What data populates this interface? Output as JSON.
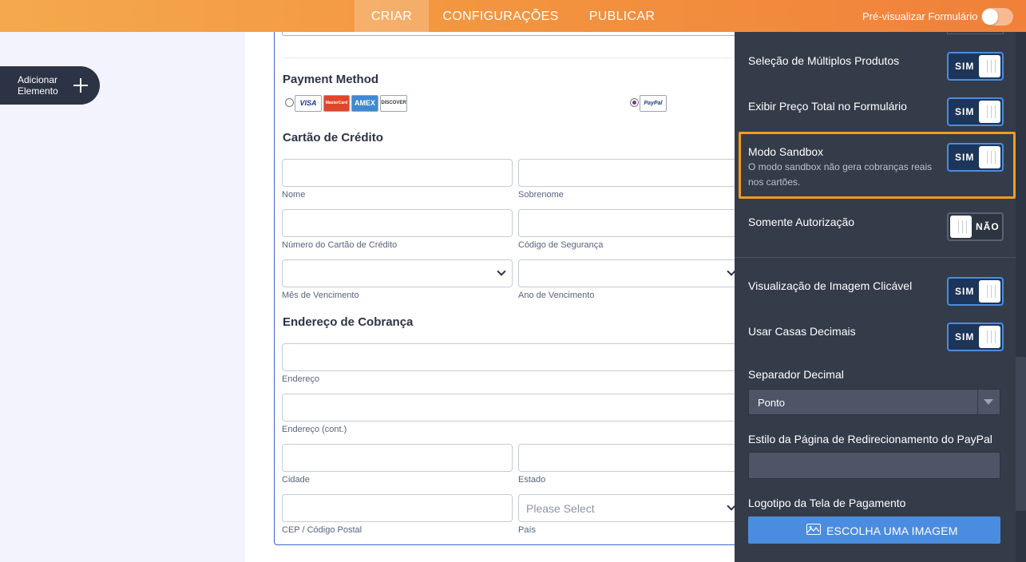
{
  "topbar": {
    "tabs": [
      {
        "label": "CRIAR",
        "active": true
      },
      {
        "label": "CONFIGURAÇÕES",
        "active": false
      },
      {
        "label": "PUBLICAR",
        "active": false
      }
    ],
    "preview_label": "Pré-visualizar Formulário",
    "preview_enabled": false
  },
  "sidebar": {
    "add_element_line1": "Adicionar",
    "add_element_line2": "Elemento"
  },
  "form": {
    "payment_method_title": "Payment Method",
    "payment_options": [
      {
        "name": "credit-cards",
        "logos": [
          "VISA",
          "MasterCard",
          "AMEX",
          "DISCOVER"
        ],
        "selected": false
      },
      {
        "name": "paypal",
        "logos": [
          "PayPal"
        ],
        "selected": true
      }
    ],
    "credit_card_title": "Cartão de Crédito",
    "credit_card_fields": {
      "first_name": "Nome",
      "last_name": "Sobrenome",
      "card_number": "Número do Cartão de Crédito",
      "security_code": "Código de Segurança",
      "exp_month": "Mês de Vencimento",
      "exp_year": "Ano de Vencimento"
    },
    "billing_title": "Endereço de Cobrança",
    "billing_fields": {
      "address": "Endereço",
      "address2": "Endereço (cont.)",
      "city": "Cidade",
      "state": "Estado",
      "zip": "CEP / Código Postal",
      "country": "País",
      "country_placeholder": "Please Select"
    }
  },
  "panel": {
    "options": [
      {
        "label": "Seleção de Múltiplos Produtos",
        "state": "SIM"
      },
      {
        "label": "Exibir Preço Total no Formulário",
        "state": "SIM"
      },
      {
        "label": "Modo Sandbox",
        "description": "O modo sandbox não gera cobranças reais nos cartões.",
        "state": "SIM",
        "highlighted": true
      },
      {
        "label": "Somente Autorização",
        "state": "NÃO"
      },
      {
        "label": "Visualização de Imagem Clicável",
        "state": "SIM"
      },
      {
        "label": "Usar Casas Decimais",
        "state": "SIM"
      }
    ],
    "decimal_separator_label": "Separador Decimal",
    "decimal_separator_value": "Ponto",
    "paypal_style_label": "Estilo da Página de Redirecionamento do PayPal",
    "paypal_style_value": "",
    "checkout_logo_label": "Logotipo da Tela de Pagamento",
    "choose_image_button": "ESCOLHA UMA IMAGEM"
  },
  "colors": {
    "accent_orange": "#f39640",
    "panel_bg": "#343c4a",
    "toggle_on_border": "#4a8de0",
    "highlight": "#f49a22",
    "button_blue": "#4a8de0"
  },
  "icons": [
    "plus-icon",
    "chevron-down-icon",
    "caret-down-icon",
    "image-icon"
  ]
}
